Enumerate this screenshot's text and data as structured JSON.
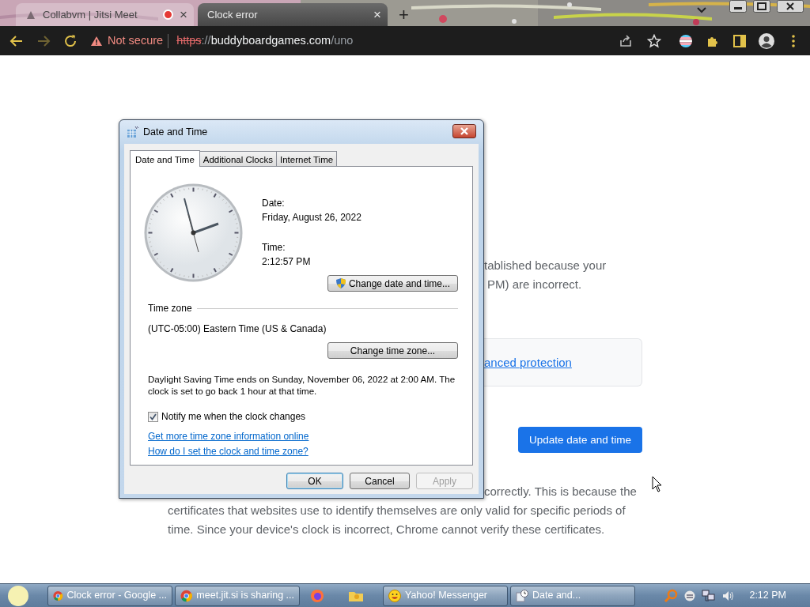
{
  "browser": {
    "tabs": [
      {
        "title": "Collabvm | Jitsi Meet",
        "recording": true,
        "selected": false,
        "close": "×"
      },
      {
        "title": "Clock error",
        "recording": false,
        "selected": true,
        "close": "×"
      }
    ],
    "new_tab": "+",
    "security": "Not secure",
    "url": [
      {
        "kind": "scheme",
        "text": "https"
      },
      {
        "kind": "sep",
        "text": "://"
      },
      {
        "kind": "host",
        "text": "buddyboardgames.com"
      },
      {
        "kind": "path",
        "text": "/uno"
      }
    ]
  },
  "page": {
    "intro_lines": [
      "tablished because your",
      "PM) are incorrect."
    ],
    "advanced_link": "anced protection",
    "update_button": "Update date and time",
    "explanation_first": "correctly. This is because the",
    "explanation_rest": "certificates that websites use to identify themselves are only valid for specific periods of time. Since your device's clock is incorrect, Chrome cannot verify these certificates."
  },
  "dialog": {
    "title": "Date and Time",
    "tabs": [
      {
        "label": "Date and Time",
        "selected": true
      },
      {
        "label": "Additional Clocks",
        "selected": false
      },
      {
        "label": "Internet Time",
        "selected": false
      }
    ],
    "date_label": "Date:",
    "date": "Friday, August 26, 2022",
    "time_label": "Time:",
    "time": "2:12:57 PM",
    "change_date_button": "Change date and time...",
    "time_zone_heading": "Time zone",
    "time_zone": "(UTC-05:00) Eastern Time (US & Canada)",
    "change_zone_button": "Change time zone...",
    "dst_note": "Daylight Saving Time ends on Sunday, November 06, 2022 at 2:00 AM. The clock is set to go back 1 hour at that time.",
    "notify": {
      "label": "Notify me when the clock changes",
      "checked": true
    },
    "links": [
      "Get more time zone information online",
      "How do I set the clock and time zone?"
    ],
    "buttons": [
      {
        "label": "OK",
        "default": true,
        "disabled": false
      },
      {
        "label": "Cancel",
        "default": false,
        "disabled": false
      },
      {
        "label": "Apply",
        "default": false,
        "disabled": true
      }
    ]
  },
  "taskbar": {
    "items": [
      {
        "kind": "window",
        "title": "Clock error - Google ..."
      },
      {
        "kind": "window",
        "title": "meet.jit.si is sharing ..."
      },
      {
        "kind": "pinned"
      },
      {
        "kind": "pinned"
      },
      {
        "kind": "window",
        "title": "Yahoo! Messenger"
      },
      {
        "kind": "window",
        "title": "Date and..."
      }
    ],
    "clock": "2:12 PM"
  }
}
